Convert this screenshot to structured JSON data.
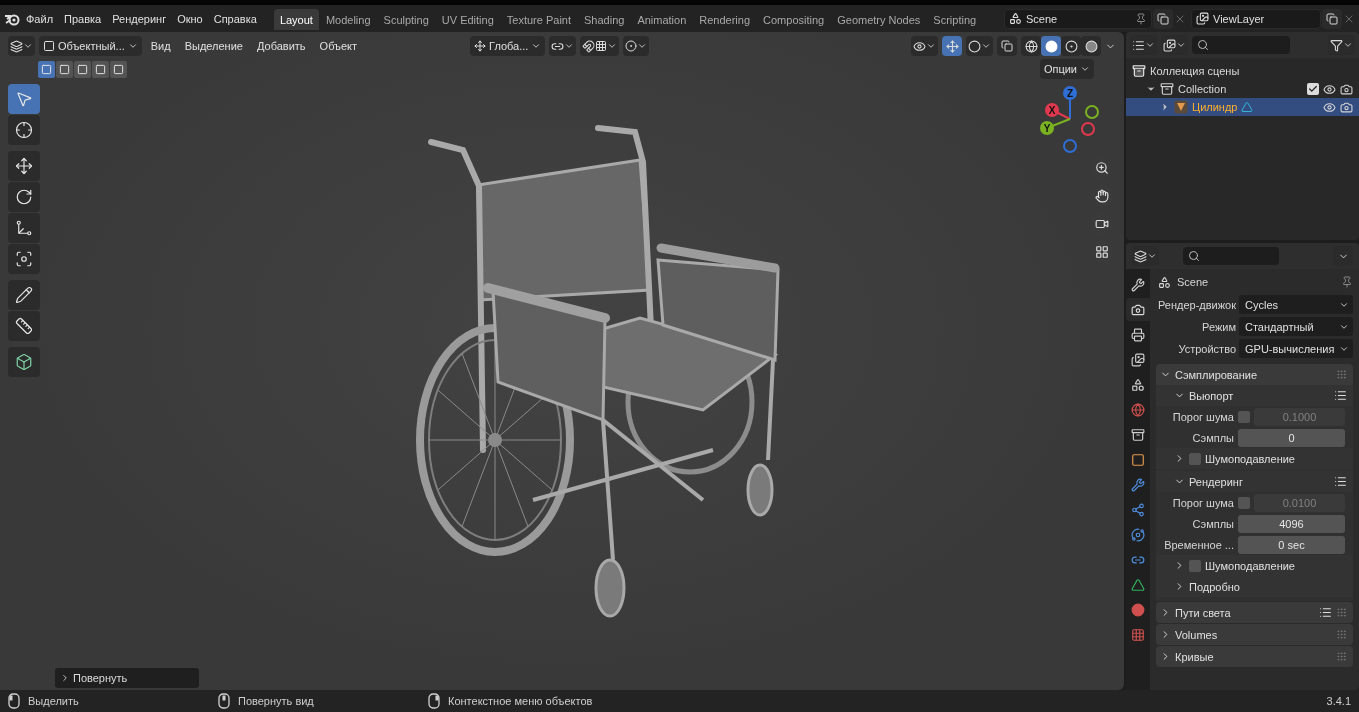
{
  "topbar": {
    "menus": [
      "Файл",
      "Правка",
      "Рендеринг",
      "Окно",
      "Справка"
    ],
    "workspaces": [
      {
        "label": "Layout",
        "selected": true
      },
      {
        "label": "Modeling",
        "selected": false
      },
      {
        "label": "Sculpting",
        "selected": false
      },
      {
        "label": "UV Editing",
        "selected": false
      },
      {
        "label": "Texture Paint",
        "selected": false
      },
      {
        "label": "Shading",
        "selected": false
      },
      {
        "label": "Animation",
        "selected": false
      },
      {
        "label": "Rendering",
        "selected": false
      },
      {
        "label": "Compositing",
        "selected": false
      },
      {
        "label": "Geometry Nodes",
        "selected": false
      },
      {
        "label": "Scripting",
        "selected": false
      }
    ],
    "scene": "Scene",
    "view_layer": "ViewLayer"
  },
  "viewport": {
    "mode": "Объектный...",
    "menus": [
      "Вид",
      "Выделение",
      "Добавить",
      "Объект"
    ],
    "orientation": "Глоба...",
    "options": "Опции",
    "select_modes": [
      {
        "selected": true
      },
      {
        "selected": false
      },
      {
        "selected": false
      },
      {
        "selected": false
      },
      {
        "selected": false
      }
    ],
    "gizmos_on": true,
    "shading": [
      {
        "kind": "wireframe",
        "selected": false
      },
      {
        "kind": "solid",
        "selected": true
      },
      {
        "kind": "material",
        "selected": false
      },
      {
        "kind": "rendered",
        "selected": false
      }
    ],
    "tool_groups": [
      [
        {
          "kind": "select",
          "selected": true
        },
        {
          "kind": "cursor",
          "selected": false
        }
      ],
      [
        {
          "kind": "move",
          "selected": false
        },
        {
          "kind": "rotate",
          "selected": false
        },
        {
          "kind": "scale",
          "selected": false
        },
        {
          "kind": "transform",
          "selected": false
        }
      ],
      [
        {
          "kind": "annotate",
          "selected": false
        },
        {
          "kind": "measure",
          "selected": false
        }
      ],
      [
        {
          "kind": "add_cube",
          "selected": false
        }
      ]
    ],
    "gizmo": {
      "axes": [
        {
          "label": "Z",
          "color": "#2e6ed6"
        },
        {
          "label": "X",
          "color": "#e0384e"
        },
        {
          "label": "Y",
          "color": "#7bb222"
        }
      ],
      "negatives": [
        {
          "color": "#7bb222"
        },
        {
          "color": "#e0384e"
        },
        {
          "color": "#2e6ed6"
        }
      ]
    },
    "last_operator": {
      "label": "Повернуть",
      "expanded": false
    }
  },
  "outliner": {
    "tree": [
      {
        "label": "Коллекция сцены",
        "kind": "scene_collection",
        "selected": false,
        "children": [
          {
            "label": "Collection",
            "kind": "collection",
            "expanded": true,
            "checked": true,
            "selected": false,
            "children": [
              {
                "label": "Цилиндр",
                "kind": "mesh",
                "expanded": false,
                "selected": true
              }
            ]
          }
        ]
      }
    ]
  },
  "properties": {
    "tabs": [
      {
        "kind": "tool",
        "selected": false
      },
      {
        "kind": "render",
        "selected": true
      },
      {
        "kind": "output",
        "selected": false
      },
      {
        "kind": "view_layer",
        "selected": false
      },
      {
        "kind": "scene",
        "selected": false
      },
      {
        "kind": "world",
        "selected": false
      },
      {
        "kind": "collection",
        "selected": false
      },
      {
        "kind": "object",
        "selected": false
      },
      {
        "kind": "modifiers",
        "selected": false
      },
      {
        "kind": "particles",
        "selected": false
      },
      {
        "kind": "physics",
        "selected": false
      },
      {
        "kind": "constraints",
        "selected": false
      },
      {
        "kind": "data",
        "selected": false
      },
      {
        "kind": "material",
        "selected": false
      },
      {
        "kind": "texture",
        "selected": false
      }
    ],
    "title": "Scene",
    "fields": [
      {
        "label": "Рендер-движок",
        "value": "Cycles"
      },
      {
        "label": "Режим",
        "value": "Стандартный"
      },
      {
        "label": "Устройство",
        "value": "GPU-вычисления"
      }
    ],
    "panels": [
      {
        "kind": "panel",
        "title": "Сэмплирование",
        "expanded": true,
        "presets": false,
        "children": [
          {
            "kind": "subpanel",
            "title": "Вьюпорт",
            "expanded": true,
            "presets": true,
            "children": [
              {
                "kind": "number",
                "label": "Порог шума",
                "checked": false,
                "value": "0.1000",
                "disabled": true
              },
              {
                "kind": "number",
                "label": "Сэмплы",
                "value": "0",
                "disabled": false
              },
              {
                "kind": "subpanel",
                "title": "Шумоподавление",
                "expanded": false,
                "checked": false,
                "presets": false
              }
            ]
          },
          {
            "kind": "subpanel",
            "title": "Рендеринг",
            "expanded": true,
            "presets": true,
            "children": [
              {
                "kind": "number",
                "label": "Порог шума",
                "checked": false,
                "value": "0.0100",
                "disabled": true
              },
              {
                "kind": "number",
                "label": "Сэмплы",
                "value": "4096",
                "disabled": false
              },
              {
                "kind": "number",
                "label": "Временное ...",
                "value": "0 sec",
                "disabled": false
              },
              {
                "kind": "subpanel",
                "title": "Шумоподавление",
                "expanded": false,
                "checked": false,
                "presets": false
              },
              {
                "kind": "subpanel",
                "title": "Подробно",
                "expanded": false,
                "presets": false
              }
            ]
          }
        ]
      },
      {
        "kind": "panel",
        "title": "Пути света",
        "expanded": false,
        "presets": true
      },
      {
        "kind": "panel",
        "title": "Volumes",
        "expanded": false,
        "presets": false
      },
      {
        "kind": "panel",
        "title": "Кривые",
        "expanded": false,
        "presets": false
      }
    ]
  },
  "status_bar": {
    "items": [
      {
        "kind": "left",
        "label": "Выделить"
      },
      {
        "kind": "middle",
        "label": "Повернуть вид"
      },
      {
        "kind": "right",
        "label": "Контекстное меню объектов"
      }
    ],
    "version": "3.4.1"
  }
}
